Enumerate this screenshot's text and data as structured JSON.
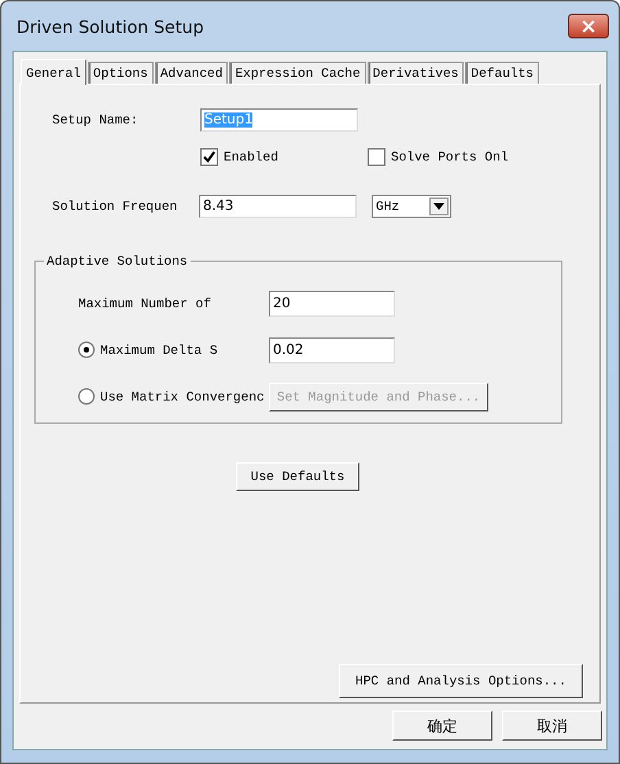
{
  "window": {
    "title": "Driven Solution Setup",
    "close": "×"
  },
  "tabs": [
    {
      "label": "General",
      "selected": true
    },
    {
      "label": "Options",
      "selected": false
    },
    {
      "label": "Advanced",
      "selected": false
    },
    {
      "label": "Expression Cache",
      "selected": false
    },
    {
      "label": "Derivatives",
      "selected": false
    },
    {
      "label": "Defaults",
      "selected": false
    }
  ],
  "setup_name": {
    "label": "Setup Name:",
    "value": "Setup1"
  },
  "checkboxes": [
    {
      "label": "Enabled",
      "checked": true
    },
    {
      "label": "Solve Ports Onl",
      "checked": false
    }
  ],
  "frequency": {
    "label": "Solution Frequen",
    "value": "8.43",
    "unit": "GHz"
  },
  "adaptive": {
    "title": "Adaptive Solutions",
    "max_passes": {
      "label": "Maximum Number of",
      "value": "20"
    },
    "options": [
      {
        "label": "Maximum Delta S",
        "selected": true,
        "kind": "field",
        "value": "0.02"
      },
      {
        "label": "Use Matrix Convergenc",
        "selected": false,
        "kind": "button",
        "button": "Set Magnitude and Phase...",
        "disabled": true
      }
    ]
  },
  "use_defaults": "Use Defaults",
  "hpc_button": "HPC and Analysis Options...",
  "buttons": [
    "确定",
    "取消"
  ]
}
